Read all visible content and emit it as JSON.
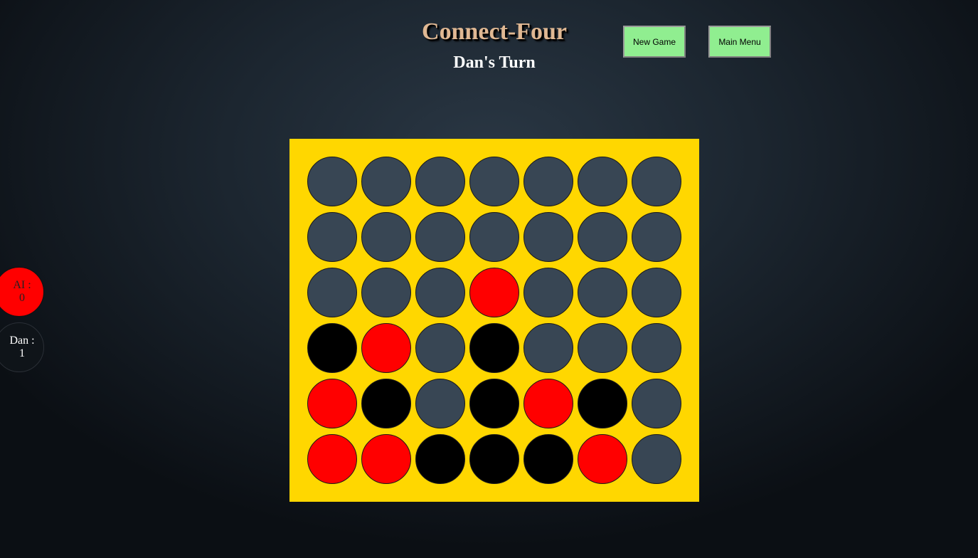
{
  "header": {
    "title": "Connect-Four",
    "turn": "Dan's Turn"
  },
  "buttons": {
    "new_game": "New Game",
    "main_menu": "Main Menu"
  },
  "scores": {
    "ai": {
      "label": "AI :",
      "value": "0",
      "color": "#ff0000"
    },
    "dan": {
      "label": "Dan :",
      "value": "1",
      "color": "#000000"
    }
  },
  "colors": {
    "board": "#ffd700",
    "empty": "#384654",
    "red": "#ff0000",
    "black": "#000000",
    "button": "#90ee90",
    "title": "#e0b893"
  },
  "board": {
    "rows": 6,
    "cols": 7,
    "cells": [
      [
        "empty",
        "empty",
        "empty",
        "empty",
        "empty",
        "empty",
        "empty"
      ],
      [
        "empty",
        "empty",
        "empty",
        "empty",
        "empty",
        "empty",
        "empty"
      ],
      [
        "empty",
        "empty",
        "empty",
        "red",
        "empty",
        "empty",
        "empty"
      ],
      [
        "black",
        "red",
        "empty",
        "black",
        "empty",
        "empty",
        "empty"
      ],
      [
        "red",
        "black",
        "empty",
        "black",
        "red",
        "black",
        "empty"
      ],
      [
        "red",
        "red",
        "black",
        "black",
        "black",
        "red",
        "empty"
      ]
    ]
  }
}
